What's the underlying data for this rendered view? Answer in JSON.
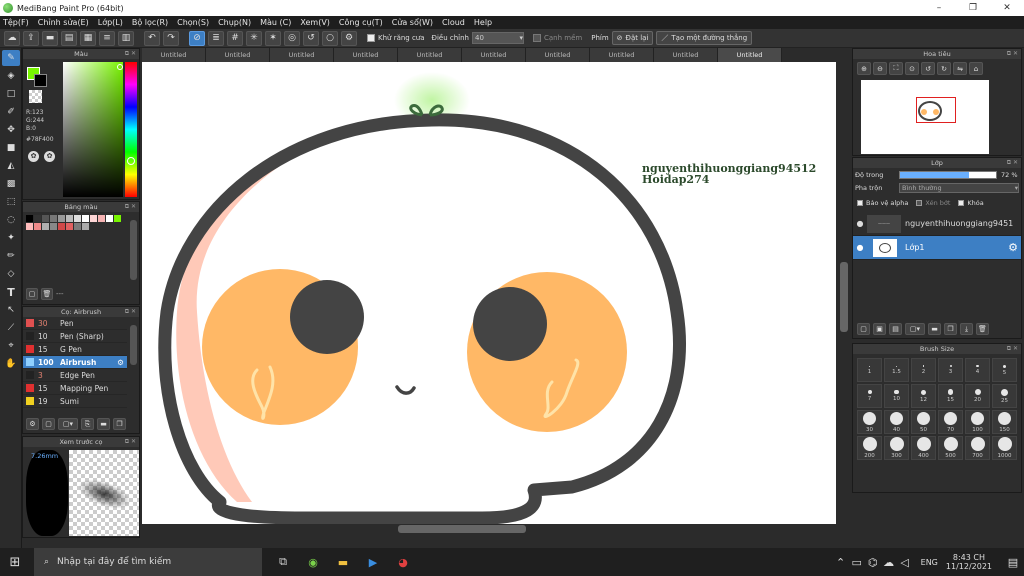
{
  "window": {
    "title": "MediBang Paint Pro (64bit)"
  },
  "menu": [
    "Tệp(F)",
    "Chỉnh sửa(E)",
    "Lớp(L)",
    "Bộ lọc(R)",
    "Chọn(S)",
    "Chụp(N)",
    "Màu (C)",
    "Xem(V)",
    "Công cụ(T)",
    "Cửa sổ(W)",
    "Cloud",
    "Help"
  ],
  "toolbar": {
    "antialias_label": "Khử răng cưa",
    "correction_label": "Điều chỉnh",
    "correction_value": "40",
    "edge_label": "Cạnh mềm",
    "snap_label": "Phím",
    "reset_label": "Đặt lại",
    "line_label": "Tạo một đường thẳng"
  },
  "doc_tabs": [
    "Untitled",
    "Untitled",
    "Untitled",
    "Untitled",
    "Untitled",
    "Untitled",
    "Untitled",
    "Untitled",
    "Untitled",
    "Untitled"
  ],
  "color_panel": {
    "title": "Màu",
    "r": "R:123",
    "g": "G:244",
    "b": "B:0",
    "hex": "#78F400",
    "fg_color": "#78f400"
  },
  "swatch_panel": {
    "title": "Bảng màu",
    "swatches": [
      "#000000",
      "#333333",
      "#555555",
      "#777777",
      "#999999",
      "#bbbbbb",
      "#dddddd",
      "#ffffff",
      "#ffd6d6",
      "#f6b3b3",
      "#ffffff",
      "#78f400",
      "#ffbcbc",
      "#f08a8a",
      "#b0b0b0",
      "#888888",
      "#d04848",
      "#e06060",
      "#7a7a7a",
      "#aaaaaa"
    ],
    "footer": "---"
  },
  "brush_panel": {
    "title": "Cọ: Airbrush",
    "brushes": [
      {
        "size": "30",
        "name": "Pen",
        "color": "#e05050"
      },
      {
        "size": "10",
        "name": "Pen (Sharp)",
        "color": "#222222"
      },
      {
        "size": "15",
        "name": "G Pen",
        "color": "#e03030"
      },
      {
        "size": "100",
        "name": "Airbrush",
        "color": "#8fd0ff"
      },
      {
        "size": "3",
        "name": "Edge Pen",
        "color": "#222222"
      },
      {
        "size": "15",
        "name": "Mapping Pen",
        "color": "#e03030"
      },
      {
        "size": "19",
        "name": "Sumi",
        "color": "#f0d020"
      }
    ]
  },
  "preview_panel": {
    "title": "Xem trước cọ",
    "size": "7.26mm"
  },
  "navigator": {
    "title": "Hoa tiêu"
  },
  "layer_panel": {
    "title": "Lớp",
    "opacity_label": "Độ trong",
    "opacity_value": "72 %",
    "blend_label": "Pha trộn",
    "blend_value": "Bình thường",
    "protect_alpha": "Bảo vệ alpha",
    "clipping": "Xén bớt",
    "lock": "Khóa",
    "layers": [
      "nguyenthihuonggiang9451",
      "Lớp1"
    ]
  },
  "brush_size_panel": {
    "title": "Brush Size",
    "sizes": [
      "1",
      "1.5",
      "2",
      "3",
      "4",
      "5",
      "7",
      "10",
      "12",
      "15",
      "20",
      "25",
      "30",
      "40",
      "50",
      "70",
      "100",
      "150",
      "200",
      "300",
      "400",
      "500",
      "700",
      "1000"
    ]
  },
  "canvas": {
    "watermark_line1": "nguyenthihuonggiang94512",
    "watermark_line2": "Hoidap274"
  },
  "taskbar": {
    "search_placeholder": "Nhập tại đây để tìm kiếm",
    "lang": "ENG",
    "time": "8:43 CH",
    "date": "11/12/2021"
  }
}
